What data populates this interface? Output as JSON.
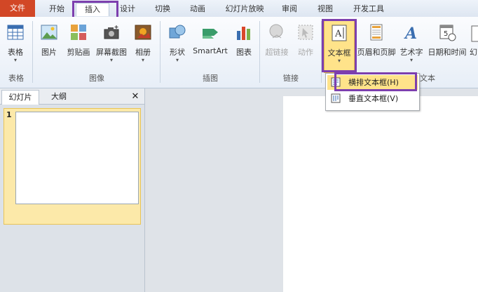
{
  "tabs": [
    "文件",
    "开始",
    "插入",
    "设计",
    "切换",
    "动画",
    "幻灯片放映",
    "审阅",
    "视图",
    "开发工具"
  ],
  "ribbon": {
    "buttons": {
      "table": "表格",
      "picture": "图片",
      "clipart": "剪贴画",
      "screenshot": "屏幕截图",
      "album": "相册",
      "shapes": "形状",
      "smartart": "SmartArt",
      "chart": "图表",
      "hyperlink": "超链接",
      "action": "动作",
      "textbox": "文本框",
      "header_footer": "页眉和页脚",
      "wordart": "艺术字",
      "datetime": "日期和时间",
      "cut_off": "幻"
    },
    "arrow": "▾",
    "groups": {
      "tables": "表格",
      "images": "图像",
      "illustrations": "插图",
      "links": "链接",
      "text": "文本"
    }
  },
  "dropdown": {
    "horizontal": "横排文本框(H)",
    "vertical": "垂直文本框(V)"
  },
  "panel": {
    "tab_slides": "幻灯片",
    "tab_outline": "大纲",
    "close": "✕",
    "slide_number": "1"
  },
  "colors": {
    "file_tab": "#d24726",
    "highlight": "#7d3fae",
    "hover": "#ffe38a"
  }
}
